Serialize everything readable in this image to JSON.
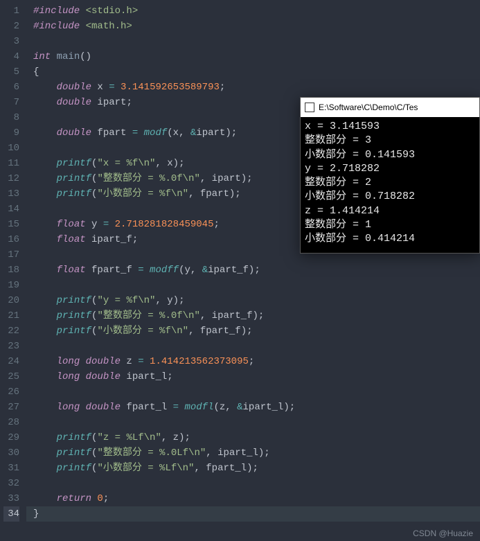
{
  "gutter": {
    "lines": 34,
    "highlighted": 34
  },
  "code": {
    "l1": {
      "inc": "#include",
      "hdr": "<stdio.h>"
    },
    "l2": {
      "inc": "#include",
      "hdr": "<math.h>"
    },
    "l4": {
      "t": "int",
      "fn": "main",
      "p": "()"
    },
    "l5": {
      "br": "{"
    },
    "l6": {
      "t": "double",
      "id": " x ",
      "eq": "=",
      "n": " 3.141592653589793",
      "end": ";"
    },
    "l7": {
      "t": "double",
      "id": " ipart",
      "end": ";"
    },
    "l9": {
      "t": "double",
      "id": " fpart ",
      "eq": "=",
      "fn": " modf",
      "args_open": "(",
      "a1": "x",
      "comma": ", ",
      "amp": "&",
      "a2": "ipart",
      "args_close": ")",
      "end": ";"
    },
    "l11": {
      "fn": "printf",
      "open": "(",
      "s": "\"x = %f\\n\"",
      "comma": ", ",
      "a": "x",
      "close": ")",
      "end": ";"
    },
    "l12": {
      "fn": "printf",
      "open": "(",
      "s": "\"整数部分 = %.0f\\n\"",
      "comma": ", ",
      "a": "ipart",
      "close": ")",
      "end": ";"
    },
    "l13": {
      "fn": "printf",
      "open": "(",
      "s": "\"小数部分 = %f\\n\"",
      "comma": ", ",
      "a": "fpart",
      "close": ")",
      "end": ";"
    },
    "l15": {
      "t": "float",
      "id": " y ",
      "eq": "=",
      "n": " 2.718281828459045",
      "end": ";"
    },
    "l16": {
      "t": "float",
      "id": " ipart_f",
      "end": ";"
    },
    "l18": {
      "t": "float",
      "id": " fpart_f ",
      "eq": "=",
      "fn": " modff",
      "args_open": "(",
      "a1": "y",
      "comma": ", ",
      "amp": "&",
      "a2": "ipart_f",
      "args_close": ")",
      "end": ";"
    },
    "l20": {
      "fn": "printf",
      "open": "(",
      "s": "\"y = %f\\n\"",
      "comma": ", ",
      "a": "y",
      "close": ")",
      "end": ";"
    },
    "l21": {
      "fn": "printf",
      "open": "(",
      "s": "\"整数部分 = %.0f\\n\"",
      "comma": ", ",
      "a": "ipart_f",
      "close": ")",
      "end": ";"
    },
    "l22": {
      "fn": "printf",
      "open": "(",
      "s": "\"小数部分 = %f\\n\"",
      "comma": ", ",
      "a": "fpart_f",
      "close": ")",
      "end": ";"
    },
    "l24": {
      "t": "long double",
      "id": " z ",
      "eq": "=",
      "n": " 1.414213562373095",
      "end": ";"
    },
    "l25": {
      "t": "long double",
      "id": " ipart_l",
      "end": ";"
    },
    "l27": {
      "t": "long double",
      "id": " fpart_l ",
      "eq": "=",
      "fn": " modfl",
      "args_open": "(",
      "a1": "z",
      "comma": ", ",
      "amp": "&",
      "a2": "ipart_l",
      "args_close": ")",
      "end": ";"
    },
    "l29": {
      "fn": "printf",
      "open": "(",
      "s": "\"z = %Lf\\n\"",
      "comma": ", ",
      "a": "z",
      "close": ")",
      "end": ";"
    },
    "l30": {
      "fn": "printf",
      "open": "(",
      "s": "\"整数部分 = %.0Lf\\n\"",
      "comma": ", ",
      "a": "ipart_l",
      "close": ")",
      "end": ";"
    },
    "l31": {
      "fn": "printf",
      "open": "(",
      "s": "\"小数部分 = %Lf\\n\"",
      "comma": ", ",
      "a": "fpart_l",
      "close": ")",
      "end": ";"
    },
    "l33": {
      "ret": "return",
      "n": " 0",
      "end": ";"
    },
    "l34": {
      "br": "}"
    }
  },
  "console": {
    "title": "E:\\Software\\C\\Demo\\C/Tes",
    "lines": [
      "x = 3.141593",
      "整数部分 = 3",
      "小数部分 = 0.141593",
      "y = 2.718282",
      "整数部分 = 2",
      "小数部分 = 0.718282",
      "z = 1.414214",
      "整数部分 = 1",
      "小数部分 = 0.414214"
    ]
  },
  "watermark": "CSDN @Huazie"
}
